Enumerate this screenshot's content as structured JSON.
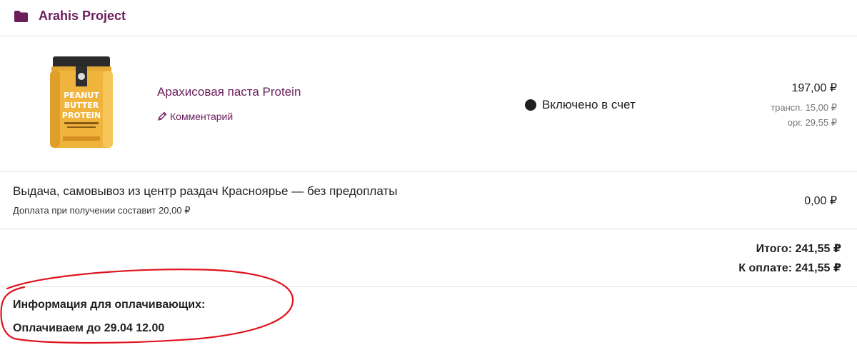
{
  "header": {
    "icon": "folder-icon",
    "project_title": "Arahis Project",
    "accent_color": "#6b1d5c"
  },
  "order_item": {
    "image_icon": "peanut-butter-jar-image",
    "jar_label_lines": [
      "PEANUT",
      "BUTTER",
      "PROTEIN"
    ],
    "name": "Арахисовая паста Protein",
    "comment_icon": "pencil-icon",
    "comment_label": "Комментарий",
    "status_icon": "status-dot-icon",
    "status_label": "Включено в счет",
    "price": "197,00 ₽",
    "transport_fee": "трансп. 15,00 ₽",
    "org_fee": "орг. 29,55 ₽"
  },
  "delivery": {
    "title": "Выдача, самовывоз из центр раздач Красноярье — без предоплаты",
    "subtitle": "Доплата при получении составит 20,00 ₽",
    "price": "0,00 ₽"
  },
  "totals": {
    "total": "Итого: 241,55 ₽",
    "to_pay": "К оплате: 241,55 ₽"
  },
  "payment_info": {
    "title": "Информация для оплачивающих:",
    "deadline": "Оплачиваем до 29.04 12.00"
  },
  "annotation_color": "#e0141e"
}
